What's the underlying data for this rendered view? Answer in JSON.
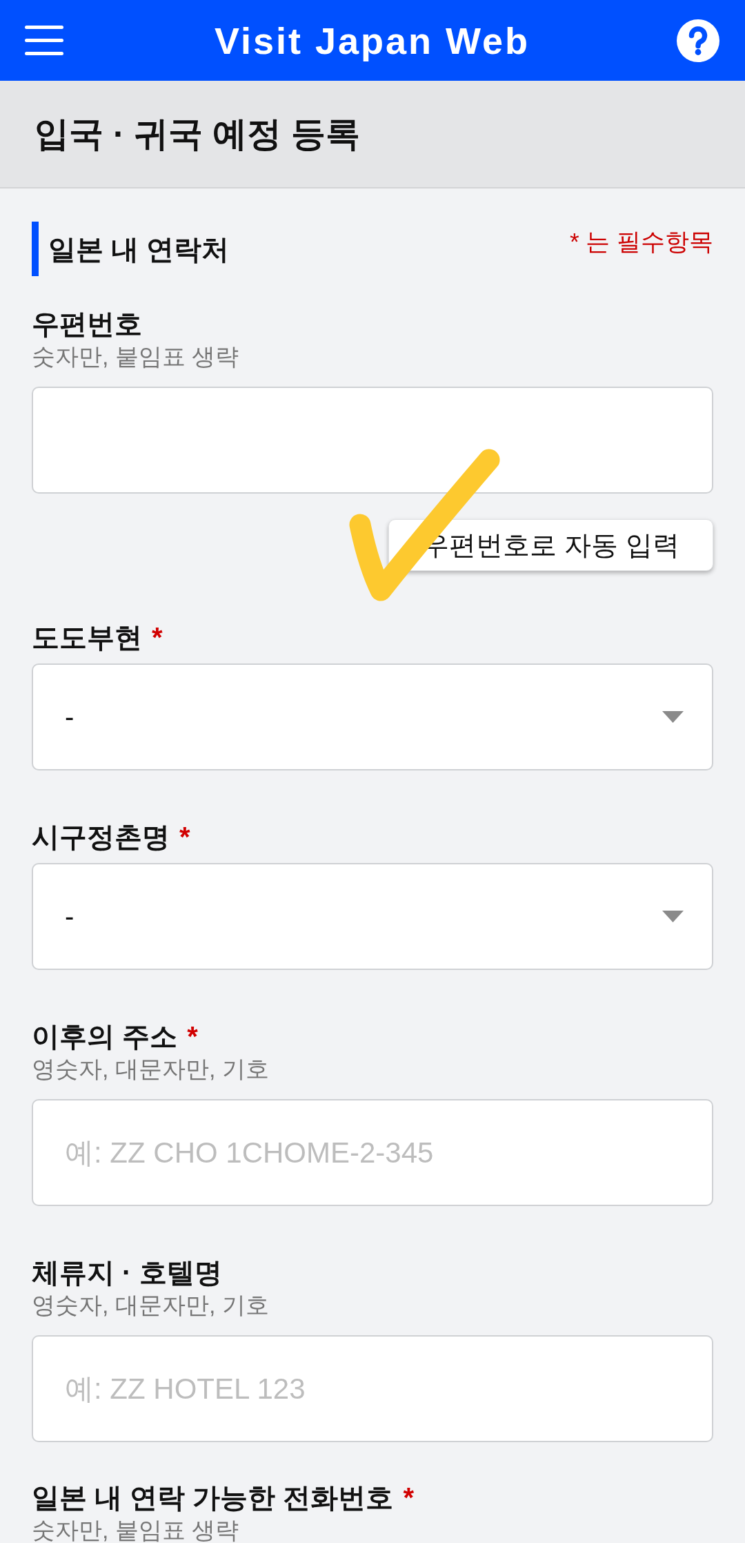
{
  "header": {
    "title": "Visit Japan Web"
  },
  "page_title": "입국 · 귀국 예정 등록",
  "section": {
    "title": "일본 내 연락처",
    "required_note": "* 는 필수항목"
  },
  "fields": [
    {
      "kind": "input",
      "label": "우편번호",
      "hint": "숫자만, 붙임표 생략",
      "action": "우편번호로 자동 입력"
    },
    {
      "kind": "select",
      "label": "도도부현",
      "required_mark": "*",
      "value": "-"
    },
    {
      "kind": "select",
      "label": "시구정촌명",
      "required_mark": "*",
      "value": "-"
    },
    {
      "kind": "input",
      "label": "이후의 주소",
      "required_mark": "*",
      "hint": "영숫자, 대문자만, 기호",
      "placeholder": "예: ZZ CHO 1CHOME-2-345"
    },
    {
      "kind": "input",
      "label": "체류지 · 호텔명",
      "hint": "영숫자, 대문자만, 기호",
      "placeholder": "예: ZZ HOTEL 123"
    },
    {
      "kind": "label_only",
      "label": "일본 내 연락 가능한 전화번호",
      "required_mark": "*",
      "hint": "숫자만, 붙임표 생략"
    }
  ]
}
